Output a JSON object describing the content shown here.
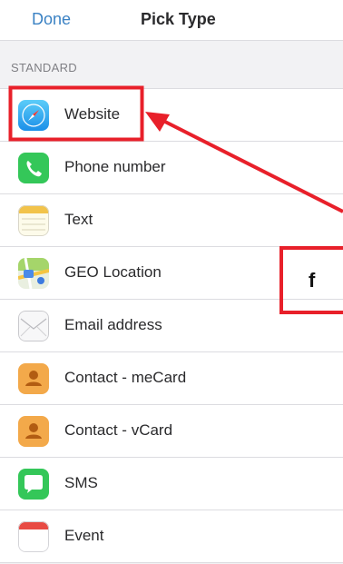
{
  "nav": {
    "done_label": "Done",
    "title": "Pick Type"
  },
  "section": {
    "header": "STANDARD"
  },
  "items": [
    {
      "label": "Website",
      "icon": "safari-compass-icon"
    },
    {
      "label": "Phone number",
      "icon": "phone-icon"
    },
    {
      "label": "Text",
      "icon": "notes-icon"
    },
    {
      "label": "GEO Location",
      "icon": "maps-icon"
    },
    {
      "label": "Email address",
      "icon": "envelope-icon"
    },
    {
      "label": "Contact - meCard",
      "icon": "contact-icon"
    },
    {
      "label": "Contact - vCard",
      "icon": "contact-icon"
    },
    {
      "label": "SMS",
      "icon": "message-bubble-icon"
    },
    {
      "label": "Event",
      "icon": "calendar-icon"
    }
  ],
  "annotation": {
    "callout_text": "f",
    "color": "#e8202a"
  },
  "colors": {
    "accent": "#3b82c4",
    "annotation_red": "#e8202a"
  }
}
